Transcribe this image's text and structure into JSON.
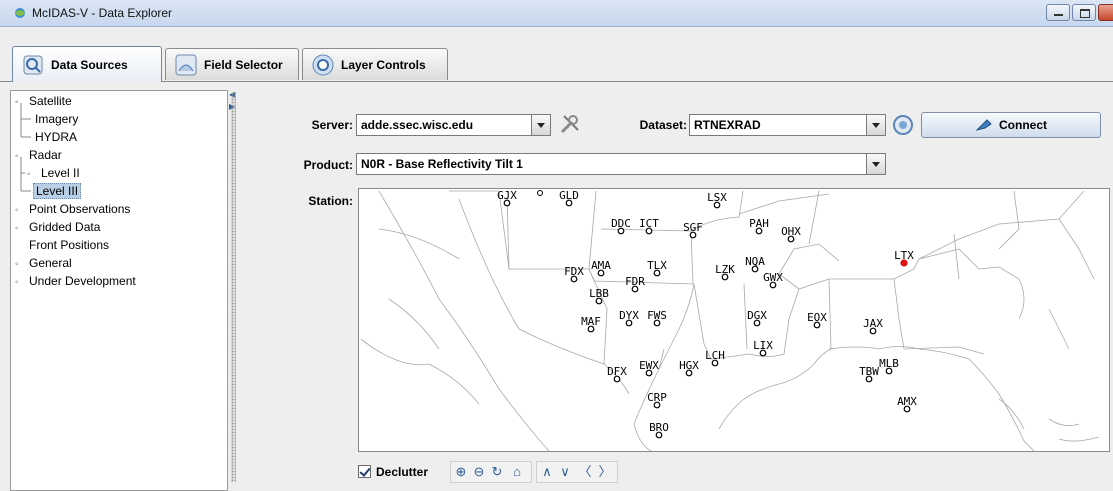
{
  "window": {
    "title": "McIDAS-V - Data Explorer"
  },
  "tabs": [
    {
      "label": "Data Sources",
      "icon": "data-sources-icon",
      "active": true
    },
    {
      "label": "Field Selector",
      "icon": "field-selector-icon",
      "active": false
    },
    {
      "label": "Layer Controls",
      "icon": "layer-controls-icon",
      "active": false
    }
  ],
  "tree": [
    {
      "label": "Satellite",
      "level": 0,
      "expanded": true
    },
    {
      "label": "Imagery",
      "level": 1
    },
    {
      "label": "HYDRA",
      "level": 1
    },
    {
      "label": "Radar",
      "level": 0,
      "expanded": true
    },
    {
      "label": "Level II",
      "level": 1,
      "collapsed": true
    },
    {
      "label": "Level III",
      "level": 1,
      "selected": true
    },
    {
      "label": "Point Observations",
      "level": 0,
      "collapsed": true
    },
    {
      "label": "Gridded Data",
      "level": 0,
      "collapsed": true
    },
    {
      "label": "Front Positions",
      "level": 0
    },
    {
      "label": "General",
      "level": 0,
      "collapsed": true
    },
    {
      "label": "Under Development",
      "level": 0,
      "collapsed": true
    }
  ],
  "form": {
    "server_label": "Server:",
    "server_value": "adde.ssec.wisc.edu",
    "dataset_label": "Dataset:",
    "dataset_value": "RTNEXRAD",
    "connect_label": "Connect",
    "product_label": "Product:",
    "product_value": "N0R - Base Reflectivity Tilt 1",
    "station_label": "Station:"
  },
  "map": {
    "selected_station": "LTX",
    "selected_color": "#e01010",
    "stations": [
      "GJX",
      "GLD",
      "LSX",
      "DDC",
      "ICT",
      "SGF",
      "PAH",
      "OHX",
      "LTX",
      "FDX",
      "AMA",
      "TLX",
      "FDR",
      "NQA",
      "LZK",
      "GWX",
      "LBB",
      "MAF",
      "DYX",
      "FWS",
      "DGX",
      "EOX",
      "JAX",
      "LIX",
      "LCH",
      "DFX",
      "EWX",
      "HGX",
      "MLB",
      "TBW",
      "CRP",
      "AMX",
      "BRO"
    ]
  },
  "controls": {
    "declutter_label": "Declutter",
    "declutter_checked": true,
    "tools": [
      "zoom-in-icon",
      "zoom-out-icon",
      "reset-zoom-icon",
      "home-icon",
      "pan-up-icon",
      "pan-down-icon",
      "pan-left-icon",
      "pan-right-icon"
    ]
  }
}
